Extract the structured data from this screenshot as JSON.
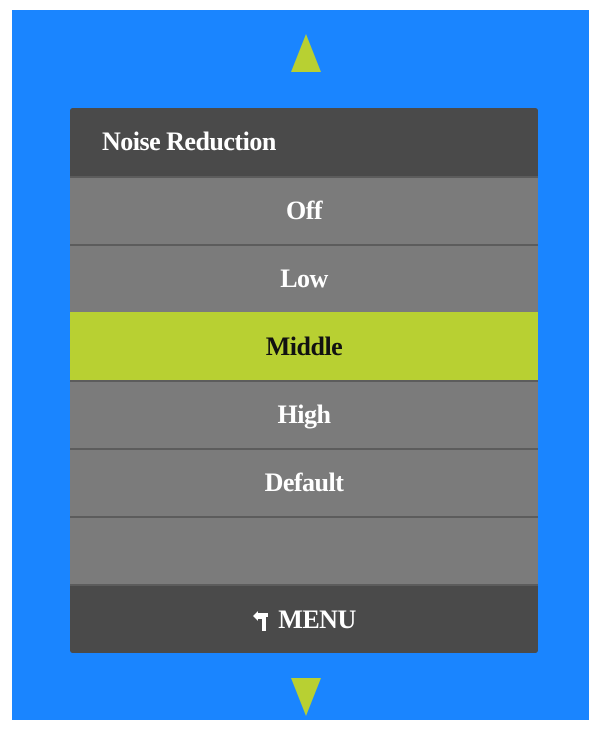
{
  "menu": {
    "title": "Noise Reduction",
    "options": [
      {
        "label": "Off",
        "selected": false
      },
      {
        "label": "Low",
        "selected": false
      },
      {
        "label": "Middle",
        "selected": true
      },
      {
        "label": "High",
        "selected": false
      },
      {
        "label": "Default",
        "selected": false
      },
      {
        "label": "",
        "selected": false
      }
    ],
    "footer_label": "MENU",
    "footer_icon": "back-arrow-icon"
  },
  "navigation": {
    "up_icon": "triangle-up-icon",
    "down_icon": "triangle-down-icon"
  },
  "colors": {
    "background": "#1a85ff",
    "panel_dark": "#4a4a4a",
    "item_gray": "#7b7b7b",
    "accent": "#b8d032"
  }
}
